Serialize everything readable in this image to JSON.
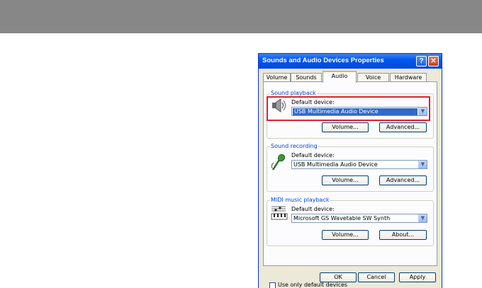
{
  "dialog": {
    "title": "Sounds and Audio Devices Properties",
    "help_glyph": "?",
    "close_glyph": "✕",
    "tabs": [
      {
        "label": "Volume"
      },
      {
        "label": "Sounds"
      },
      {
        "label": "Audio",
        "active": true
      },
      {
        "label": "Voice"
      },
      {
        "label": "Hardware"
      }
    ]
  },
  "sound_playback": {
    "group_label": "Sound playback",
    "field_label": "Default device:",
    "device": "USB Multimedia Audio Device",
    "volume_button": "Volume...",
    "advanced_button": "Advanced...",
    "icon": "speaker-icon"
  },
  "sound_recording": {
    "group_label": "Sound recording",
    "field_label": "Default device:",
    "device": "USB Multimedia Audio Device",
    "volume_button": "Volume...",
    "advanced_button": "Advanced...",
    "icon": "microphone-icon"
  },
  "midi_playback": {
    "group_label": "MIDI music playback",
    "field_label": "Default device:",
    "device": "Microsoft GS Wavetable SW Synth",
    "volume_button": "Volume...",
    "about_button": "About...",
    "icon": "midi-keyboard-icon"
  },
  "use_only_default": {
    "label": "Use only default devices",
    "checked": false
  },
  "footer": {
    "ok": "OK",
    "cancel": "Cancel",
    "apply": "Apply"
  },
  "colors": {
    "highlight": "#e0212b",
    "selection": "#316ac5",
    "titlebar": "#0058ee",
    "group_label": "#0046d5"
  }
}
